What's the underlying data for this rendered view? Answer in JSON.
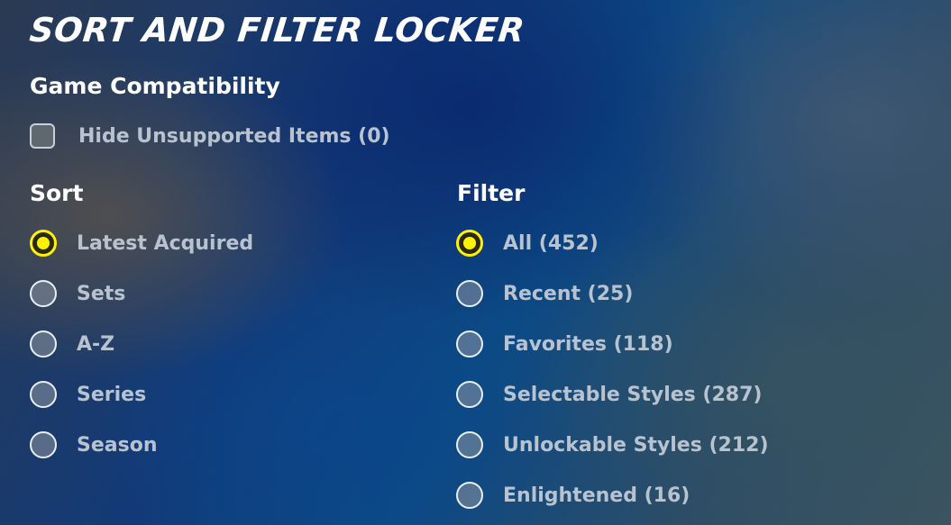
{
  "title": "SORT AND FILTER LOCKER",
  "game_compatibility": {
    "heading": "Game Compatibility",
    "hide_unsupported": {
      "label": "Hide Unsupported Items (0)",
      "checked": false
    }
  },
  "sort": {
    "heading": "Sort",
    "selected": "Latest Acquired",
    "options": [
      "Latest Acquired",
      "Sets",
      "A-Z",
      "Series",
      "Season"
    ]
  },
  "filter": {
    "heading": "Filter",
    "selected": "All (452)",
    "options": [
      "All (452)",
      "Recent (25)",
      "Favorites (118)",
      "Selectable Styles (287)",
      "Unlockable Styles (212)",
      "Enlightened (16)"
    ]
  },
  "colors": {
    "accent_selected": "#fff200",
    "text_primary": "#ffffff",
    "text_option": "#b9c3cf"
  }
}
